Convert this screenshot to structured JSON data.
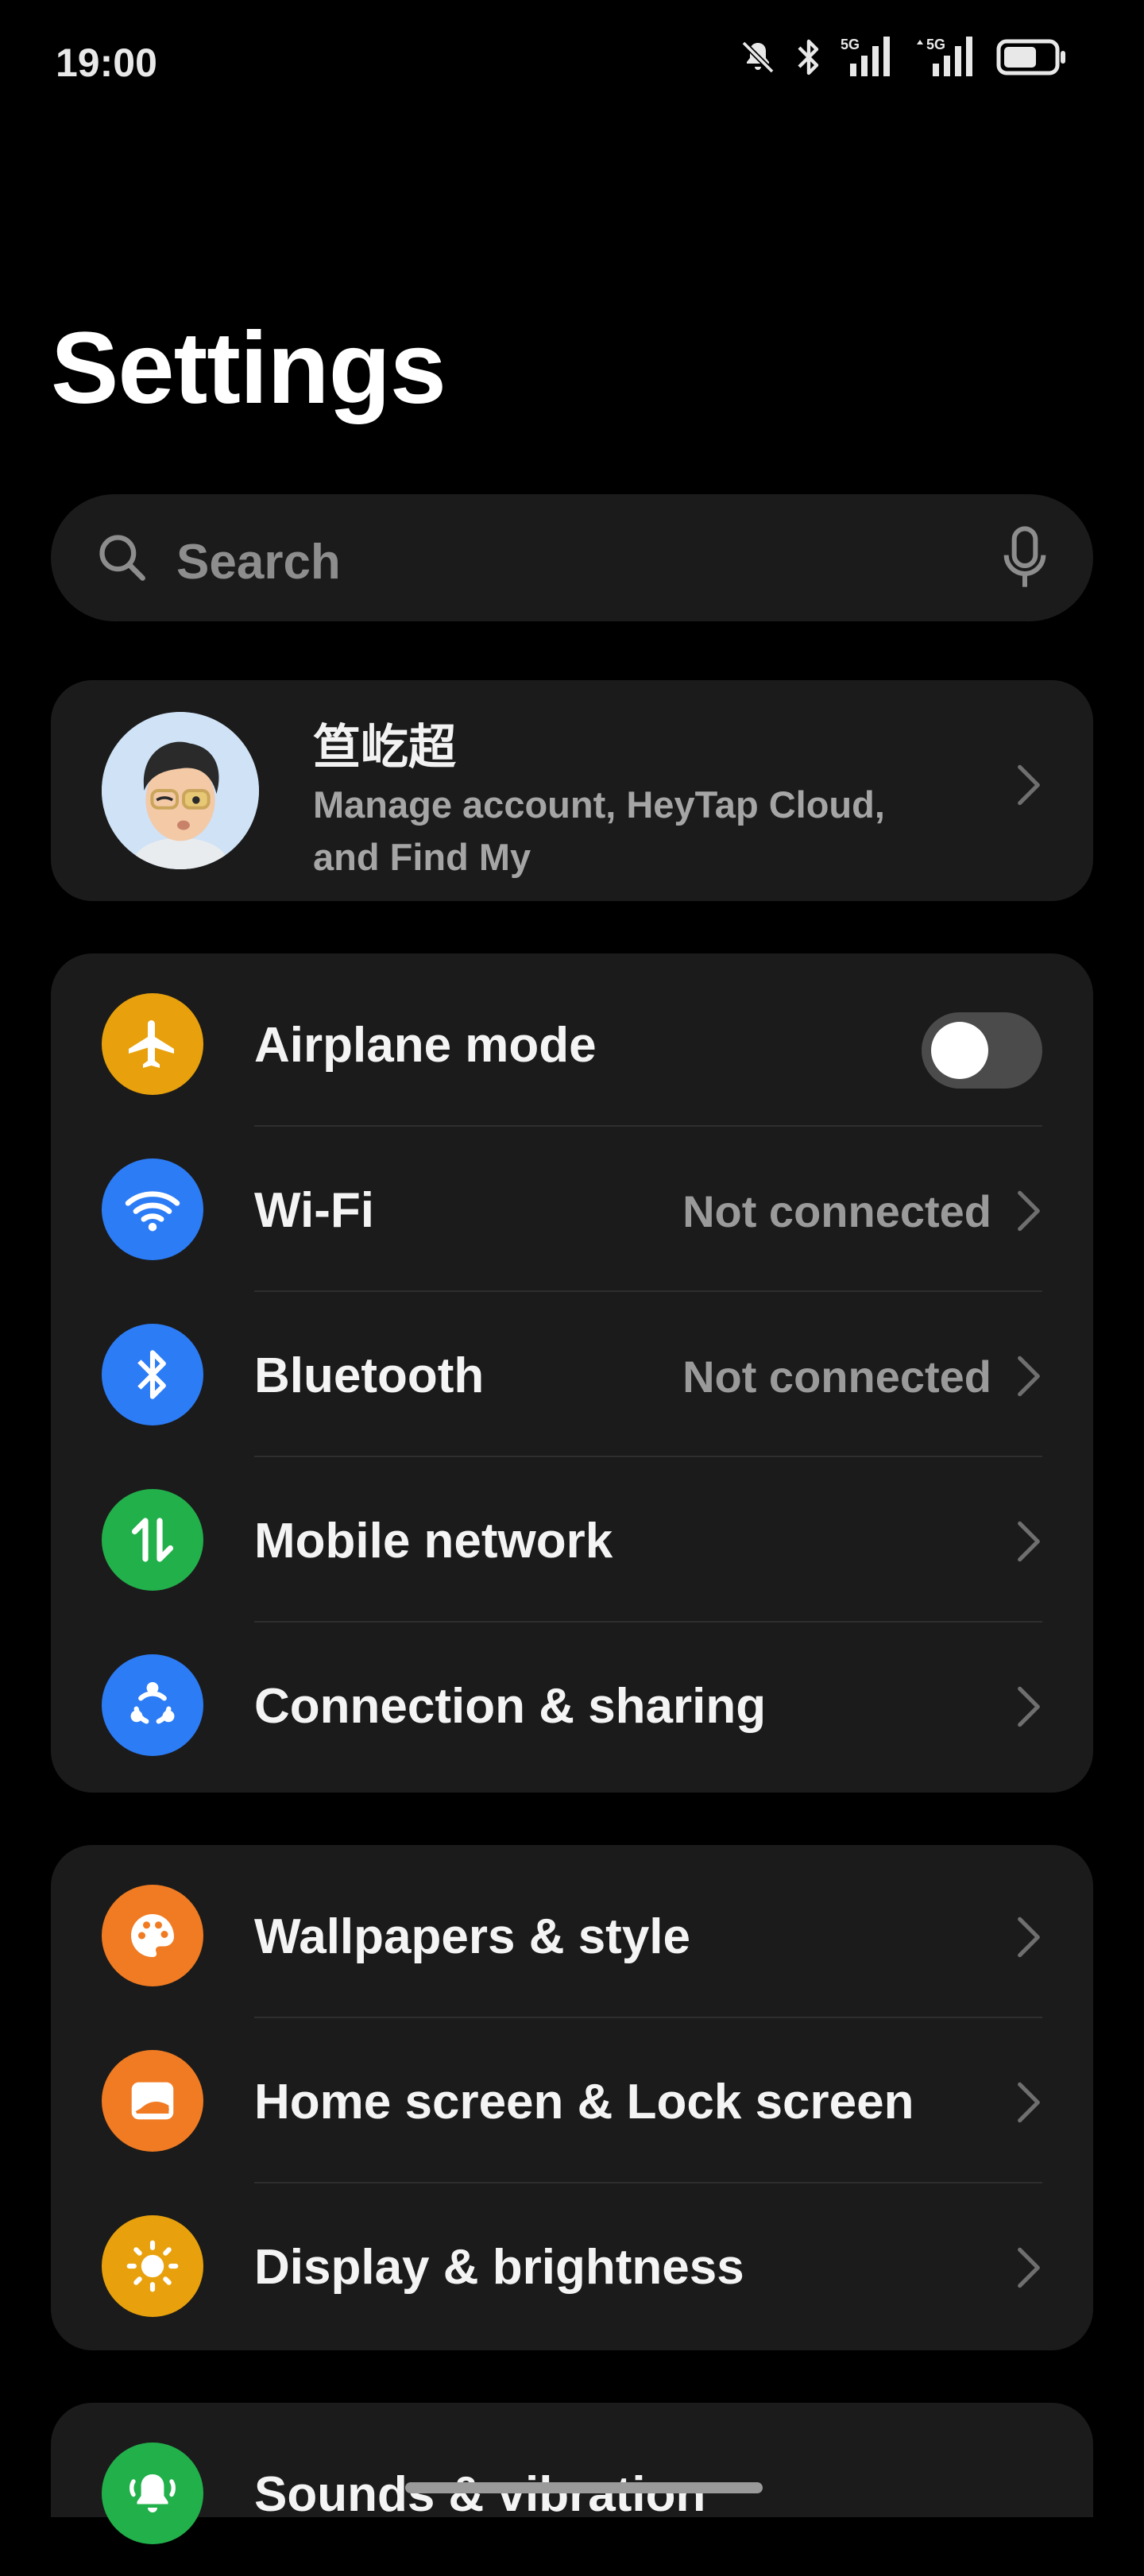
{
  "status_bar": {
    "time": "19:00",
    "icons": [
      "mute-bell-icon",
      "bluetooth-icon",
      "signal-5g-icon",
      "signal-5g-icon",
      "battery-icon"
    ],
    "network_labels": [
      "5G",
      "5G"
    ]
  },
  "page_title": "Settings",
  "search": {
    "placeholder": "Search"
  },
  "account": {
    "name": "笪屹超",
    "subtitle": "Manage account, HeyTap Cloud, and Find My"
  },
  "groups": [
    {
      "rows": [
        {
          "label": "Airplane mode",
          "icon": "airplane-icon",
          "color": "#E8A10C",
          "toggle": false
        },
        {
          "label": "Wi-Fi",
          "icon": "wifi-icon",
          "color": "#2C7CF6",
          "value": "Not connected"
        },
        {
          "label": "Bluetooth",
          "icon": "bluetooth-icon",
          "color": "#2C7CF6",
          "value": "Not connected"
        },
        {
          "label": "Mobile network",
          "icon": "mobile-data-icon",
          "color": "#22B04B"
        },
        {
          "label": "Connection & sharing",
          "icon": "share-icon",
          "color": "#2C7CF6"
        }
      ]
    },
    {
      "rows": [
        {
          "label": "Wallpapers & style",
          "icon": "palette-icon",
          "color": "#F07B22"
        },
        {
          "label": "Home screen & Lock screen",
          "icon": "picture-icon",
          "color": "#F07B22"
        },
        {
          "label": "Display & brightness",
          "icon": "sun-icon",
          "color": "#E8A10C"
        }
      ]
    },
    {
      "rows": [
        {
          "label": "Sounds & vibration",
          "icon": "bell-ringing-icon",
          "color": "#22B04B"
        }
      ]
    }
  ]
}
